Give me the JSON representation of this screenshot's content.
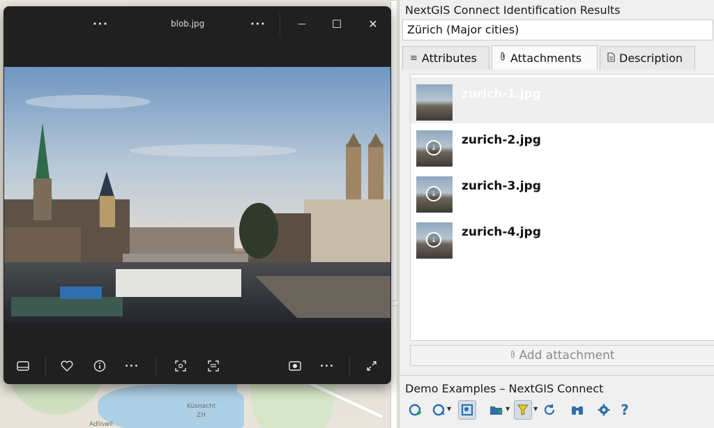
{
  "viewer": {
    "title": "blob.jpg",
    "menu_dots_left": "•••",
    "menu_dots_right": "•••",
    "minimize_glyph": "—",
    "maximize_glyph": "☐",
    "close_glyph": "✕",
    "bottom_icons": [
      "filmstrip-icon",
      "heart-icon",
      "info-icon",
      "more-icon",
      "crop-icon",
      "ocr-icon",
      "slideshow-icon",
      "more-icon",
      "expand-icon"
    ]
  },
  "map": {
    "labels": [
      "Küsnacht",
      "ZH",
      "Adliswil"
    ]
  },
  "panel": {
    "title": "NextGIS Connect Identification Results",
    "feature_combo": "Zürich (Major cities)",
    "tabs": [
      {
        "label": "Attributes",
        "icon": "list-icon"
      },
      {
        "label": "Attachments",
        "icon": "paperclip-icon"
      },
      {
        "label": "Description",
        "icon": "document-icon"
      }
    ],
    "active_tab": "Attachments",
    "attachments": [
      {
        "name": "zurich-1.jpg",
        "downloaded": true
      },
      {
        "name": "zurich-2.jpg",
        "downloaded": false
      },
      {
        "name": "zurich-3.jpg",
        "downloaded": false
      },
      {
        "name": "zurich-4.jpg",
        "downloaded": false
      }
    ],
    "add_attachment_label": "Add attachment",
    "footer_title": "Demo Examples – NextGIS Connect",
    "toolbar_tools": [
      "add-layer-icon",
      "add-layer-dropdown-icon",
      "identify-icon",
      "new-folder-icon",
      "filter-icon",
      "refresh-icon",
      "binoculars-icon",
      "settings-icon",
      "help-icon"
    ],
    "help_glyph": "?"
  },
  "colors": {
    "viewer_bg": "#202020",
    "panel_bg": "#f0f0f0",
    "accent_blue": "#1f6fb8",
    "filter_yellow": "#e8c52a"
  }
}
